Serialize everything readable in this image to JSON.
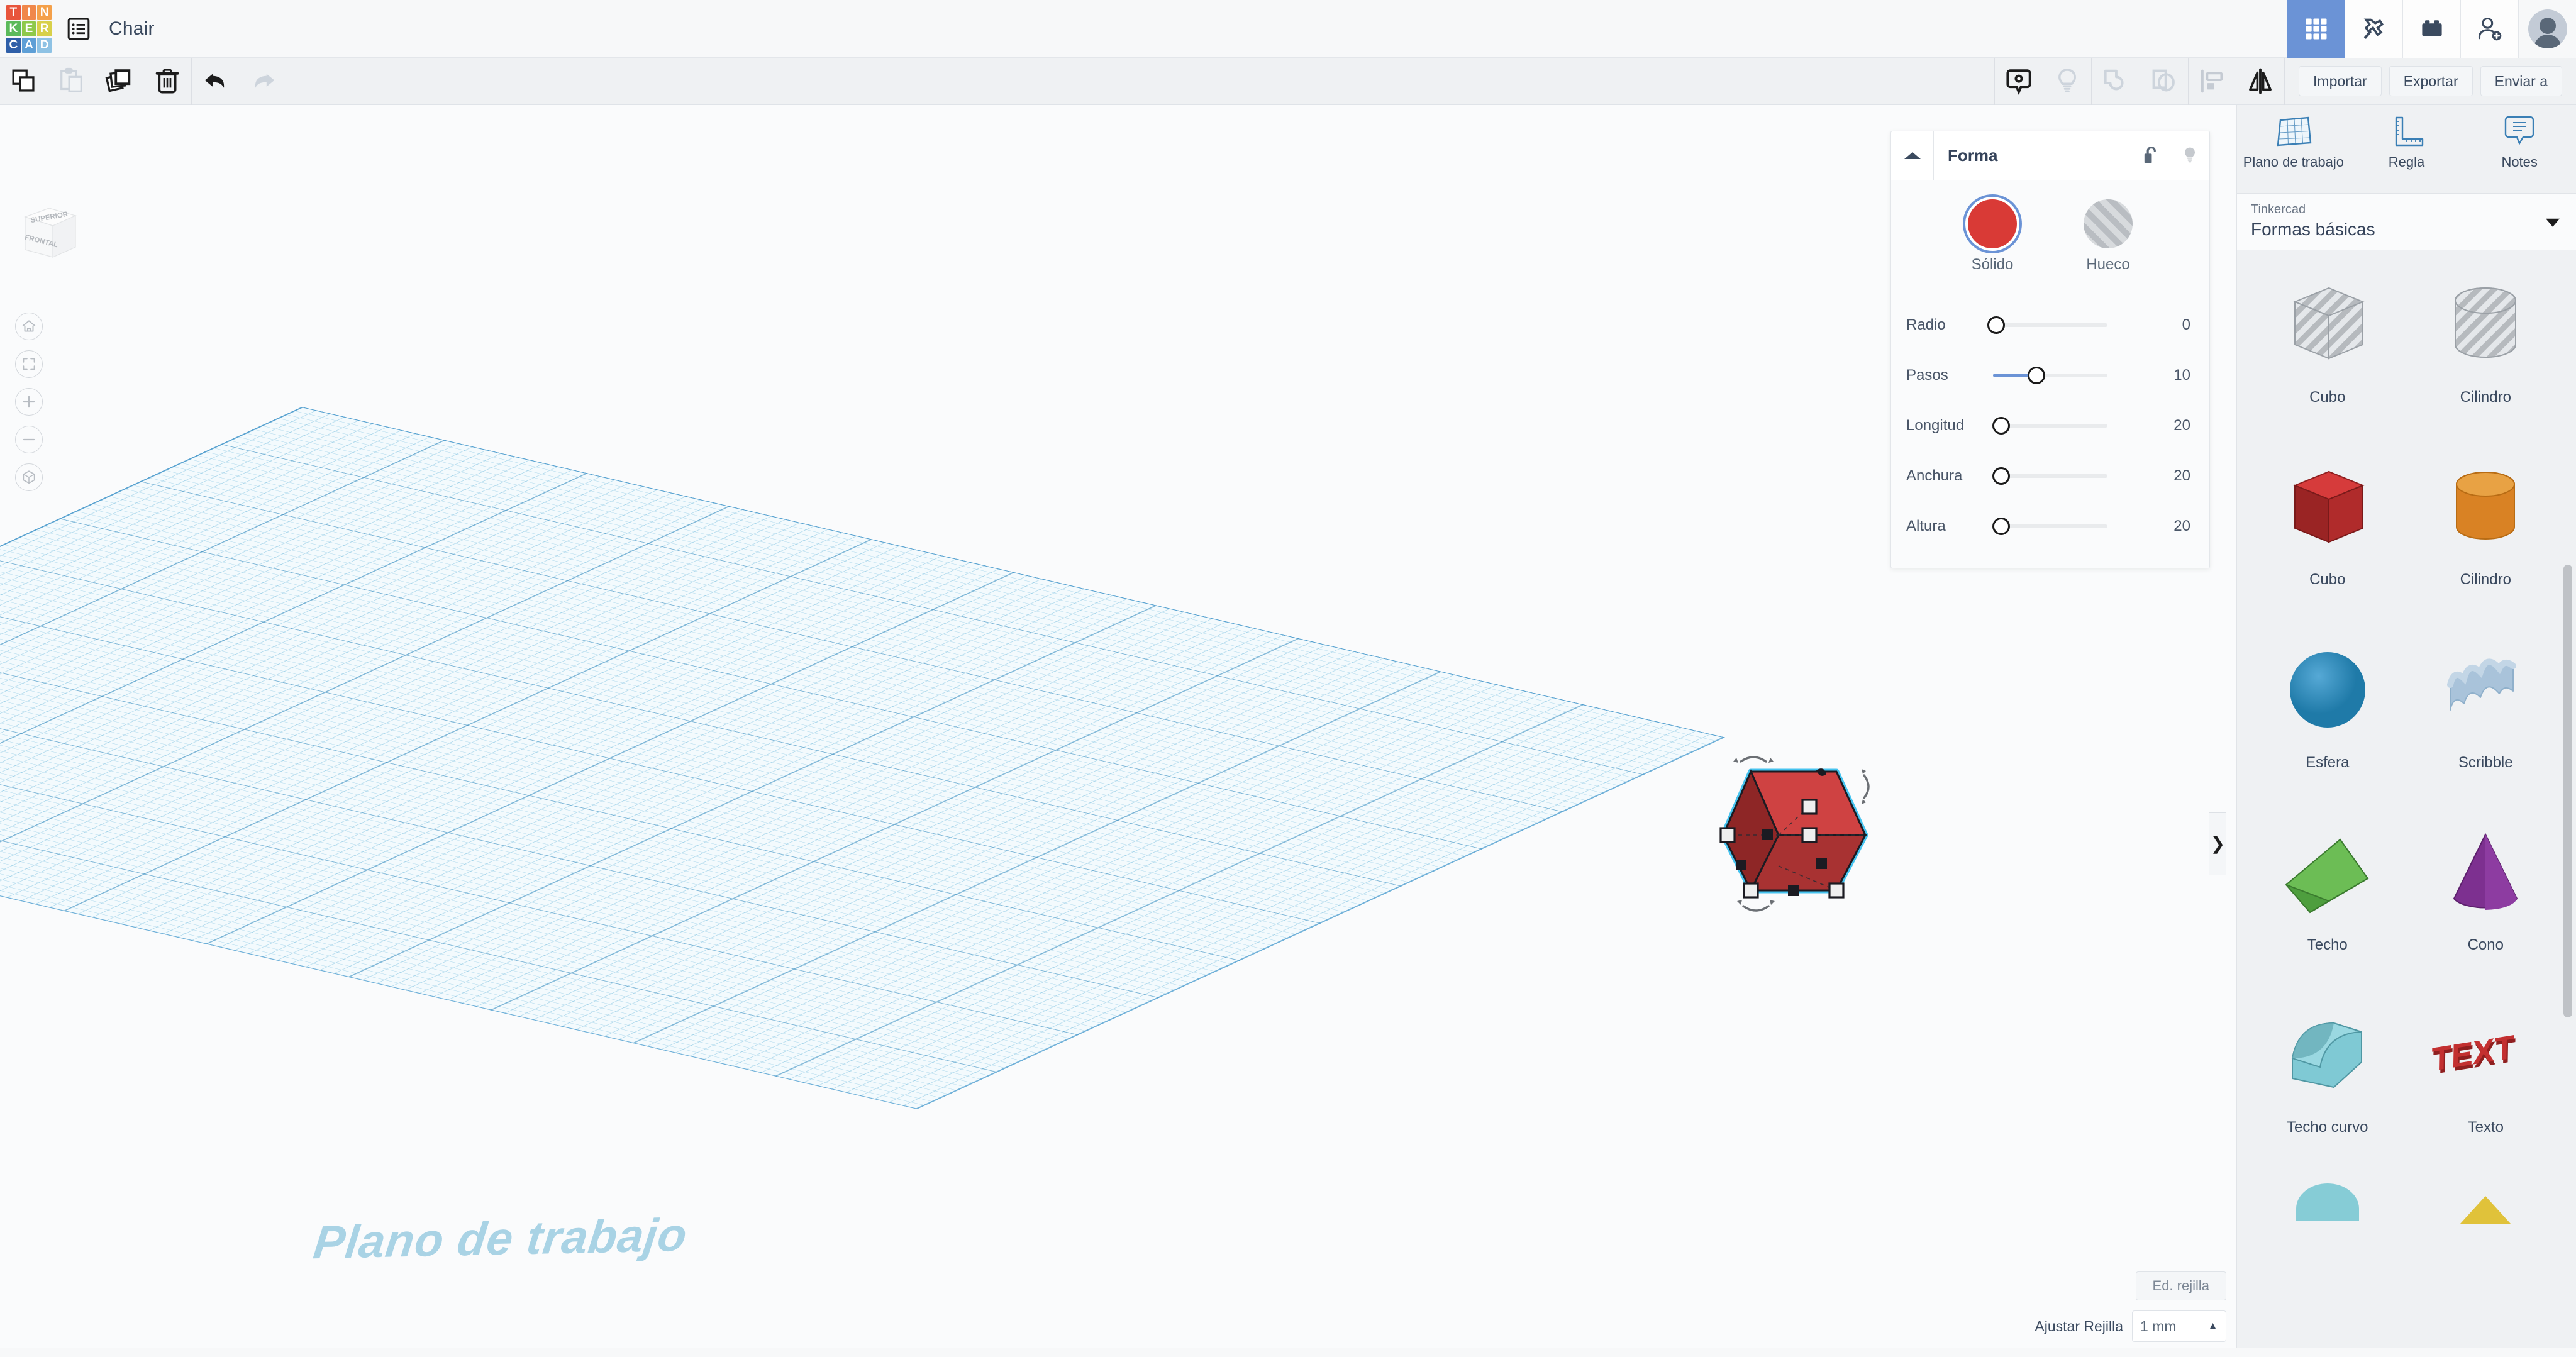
{
  "app": {
    "logo_letters": [
      {
        "char": "T",
        "color": "#e8553c"
      },
      {
        "char": "I",
        "color": "#f0874a"
      },
      {
        "char": "N",
        "color": "#f4a04a"
      },
      {
        "char": "K",
        "color": "#5bba5b"
      },
      {
        "char": "E",
        "color": "#8fc94a"
      },
      {
        "char": "R",
        "color": "#d8d04a"
      },
      {
        "char": "C",
        "color": "#2f5fa8"
      },
      {
        "char": "A",
        "color": "#5e9fd6"
      },
      {
        "char": "D",
        "color": "#8ec2e4"
      }
    ],
    "document_title": "Chair",
    "accent_blue": "#6b93d6",
    "text_dark": "#3b4a5f"
  },
  "topbar": {
    "doc_list_icon": "list-icon",
    "right_icons": [
      {
        "name": "apps-grid-icon",
        "active": true
      },
      {
        "name": "pickaxe-icon",
        "active": false
      },
      {
        "name": "lego-brick-icon",
        "active": false
      },
      {
        "name": "add-person-icon",
        "active": false
      }
    ],
    "avatar_label": "avatar"
  },
  "toolbar": {
    "items": [
      {
        "name": "copy-icon",
        "label": "Copiar",
        "enabled": true
      },
      {
        "name": "paste-icon",
        "label": "Pegar",
        "enabled": false
      },
      {
        "name": "duplicate-icon",
        "label": "Duplicar",
        "enabled": true
      },
      {
        "name": "delete-icon",
        "label": "Eliminar",
        "enabled": true
      },
      {
        "name": "undo-icon",
        "label": "Deshacer",
        "enabled": true
      },
      {
        "name": "redo-icon",
        "label": "Rehacer",
        "enabled": false
      }
    ],
    "right_items": [
      {
        "name": "note-icon",
        "label": "Nota",
        "enabled": true
      },
      {
        "name": "lightbulb-icon",
        "label": "Luz",
        "enabled": false
      },
      {
        "name": "group-icon",
        "label": "Agrupar",
        "enabled": false
      },
      {
        "name": "ungroup-icon",
        "label": "Desagrupar",
        "enabled": false
      },
      {
        "name": "align-icon",
        "label": "Alinear",
        "enabled": true
      },
      {
        "name": "mirror-icon",
        "label": "Reflejar",
        "enabled": true
      }
    ],
    "actions": [
      {
        "label": "Importar"
      },
      {
        "label": "Exportar"
      },
      {
        "label": "Enviar a"
      }
    ]
  },
  "canvas": {
    "workplane_label": "Plano de trabajo",
    "viewcube": {
      "top_face": "SUPERIOR",
      "front_face": "FRONTAL"
    },
    "nav_buttons": [
      {
        "name": "home-view-icon"
      },
      {
        "name": "fit-to-view-icon"
      },
      {
        "name": "zoom-in-icon"
      },
      {
        "name": "zoom-out-icon"
      },
      {
        "name": "orthographic-toggle-icon"
      }
    ],
    "collapse_tab_glyph": "❯",
    "selected_shape": {
      "name": "cube-solid",
      "fill_top": "#cf4242",
      "fill_left": "#8e2626",
      "fill_right": "#a82f2f",
      "selection_color": "#45c3ef"
    },
    "grid_controls": {
      "edit_grid_label": "Ed. rejilla",
      "snap_label": "Ajustar Rejilla",
      "snap_value": "1 mm"
    }
  },
  "forma_panel": {
    "title": "Forma",
    "collapse_icon": "chevron-up-icon",
    "lock_icon": "unlock-icon",
    "light_icon": "lightbulb-icon",
    "modes": [
      {
        "label": "Sólido",
        "selected": true,
        "color": "#d93a36",
        "name": "solid-swatch"
      },
      {
        "label": "Hueco",
        "selected": false,
        "color": "#c4c8cc",
        "name": "hole-swatch"
      }
    ],
    "sliders": [
      {
        "label": "Radio",
        "value": "0",
        "fill_pct": 0,
        "knob_pct": 0
      },
      {
        "label": "Pasos",
        "value": "10",
        "fill_pct": 38,
        "knob_pct": 38
      },
      {
        "label": "Longitud",
        "value": "20",
        "fill_pct": 0,
        "knob_pct": 4
      },
      {
        "label": "Anchura",
        "value": "20",
        "fill_pct": 0,
        "knob_pct": 4
      },
      {
        "label": "Altura",
        "value": "20",
        "fill_pct": 0,
        "knob_pct": 4
      }
    ]
  },
  "sidebar": {
    "tools": [
      {
        "label": "Plano de trabajo",
        "name": "workplane-tool",
        "icon": "workplane-grid-icon"
      },
      {
        "label": "Regla",
        "name": "ruler-tool",
        "icon": "ruler-icon"
      },
      {
        "label": "Notes",
        "name": "notes-tool",
        "icon": "note-bubble-icon"
      }
    ],
    "library_select": {
      "supertitle": "Tinkercad",
      "value": "Formas básicas"
    },
    "shapes": [
      {
        "label": "Cubo",
        "kind": "cube",
        "style": "hole"
      },
      {
        "label": "Cilindro",
        "kind": "cylinder",
        "style": "hole"
      },
      {
        "label": "Cubo",
        "kind": "cube",
        "style": "solid",
        "color": "#bf2e2e",
        "color_top": "#d63b3b",
        "color_side": "#8f1f1f"
      },
      {
        "label": "Cilindro",
        "kind": "cylinder",
        "style": "solid",
        "color": "#e08a2a",
        "color_top": "#e8a244",
        "color_side": "#c97618"
      },
      {
        "label": "Esfera",
        "kind": "sphere",
        "style": "solid",
        "color": "#2a86b8"
      },
      {
        "label": "Scribble",
        "kind": "scribble",
        "style": "solid",
        "color": "#a9c3da"
      },
      {
        "label": "Techo",
        "kind": "roof",
        "style": "solid",
        "color": "#4e9e3e",
        "color_top": "#6cbd55",
        "color_side": "#3a7a2e"
      },
      {
        "label": "Cono",
        "kind": "cone",
        "style": "solid",
        "color": "#7d3090"
      },
      {
        "label": "Techo curvo",
        "kind": "curved-roof",
        "style": "solid",
        "color": "#76c3ce",
        "color_side": "#5aa3ae"
      },
      {
        "label": "Texto",
        "kind": "text",
        "style": "solid",
        "color": "#b52b2b",
        "glyph": "TEXT"
      }
    ]
  }
}
